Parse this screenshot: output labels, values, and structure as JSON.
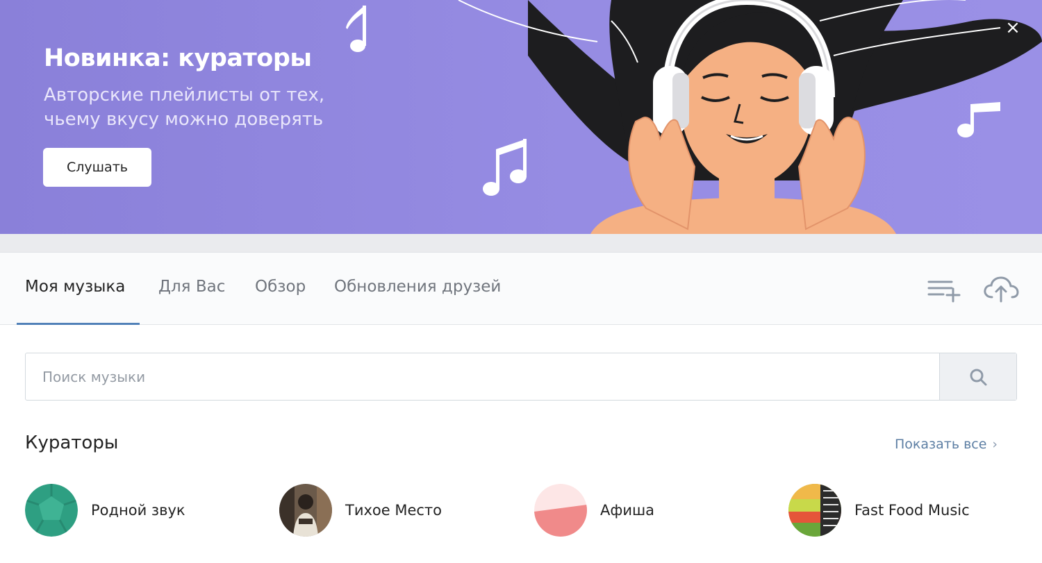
{
  "banner": {
    "title": "Новинка: кураторы",
    "subtitle_line1": "Авторские плейлисты от тех,",
    "subtitle_line2": "чьему вкусу можно доверять",
    "button_label": "Слушать",
    "close_symbol": "×",
    "background_color": "#968ce3"
  },
  "tabs": [
    {
      "label": "Моя музыка",
      "active": true
    },
    {
      "label": "Для Вас",
      "active": false
    },
    {
      "label": "Обзор",
      "active": false
    },
    {
      "label": "Обновления друзей",
      "active": false
    }
  ],
  "toolbar_icons": [
    "playlist-add-icon",
    "cloud-upload-icon"
  ],
  "search": {
    "placeholder": "Поиск музыки",
    "value": "",
    "icon": "search-icon"
  },
  "curators_section": {
    "title": "Кураторы",
    "show_all_label": "Показать все",
    "show_all_chevron": "›",
    "items": [
      {
        "name": "Родной звук",
        "avatar_color": "#2e9f82"
      },
      {
        "name": "Тихое Место",
        "avatar_color": "#5b4a3c"
      },
      {
        "name": "Афиша",
        "avatar_color": "#f08a8a"
      },
      {
        "name": "Fast Food Music",
        "avatar_color": "#7fb24a"
      }
    ]
  },
  "colors": {
    "accent": "#5181b8",
    "link": "#5c7ea3"
  }
}
